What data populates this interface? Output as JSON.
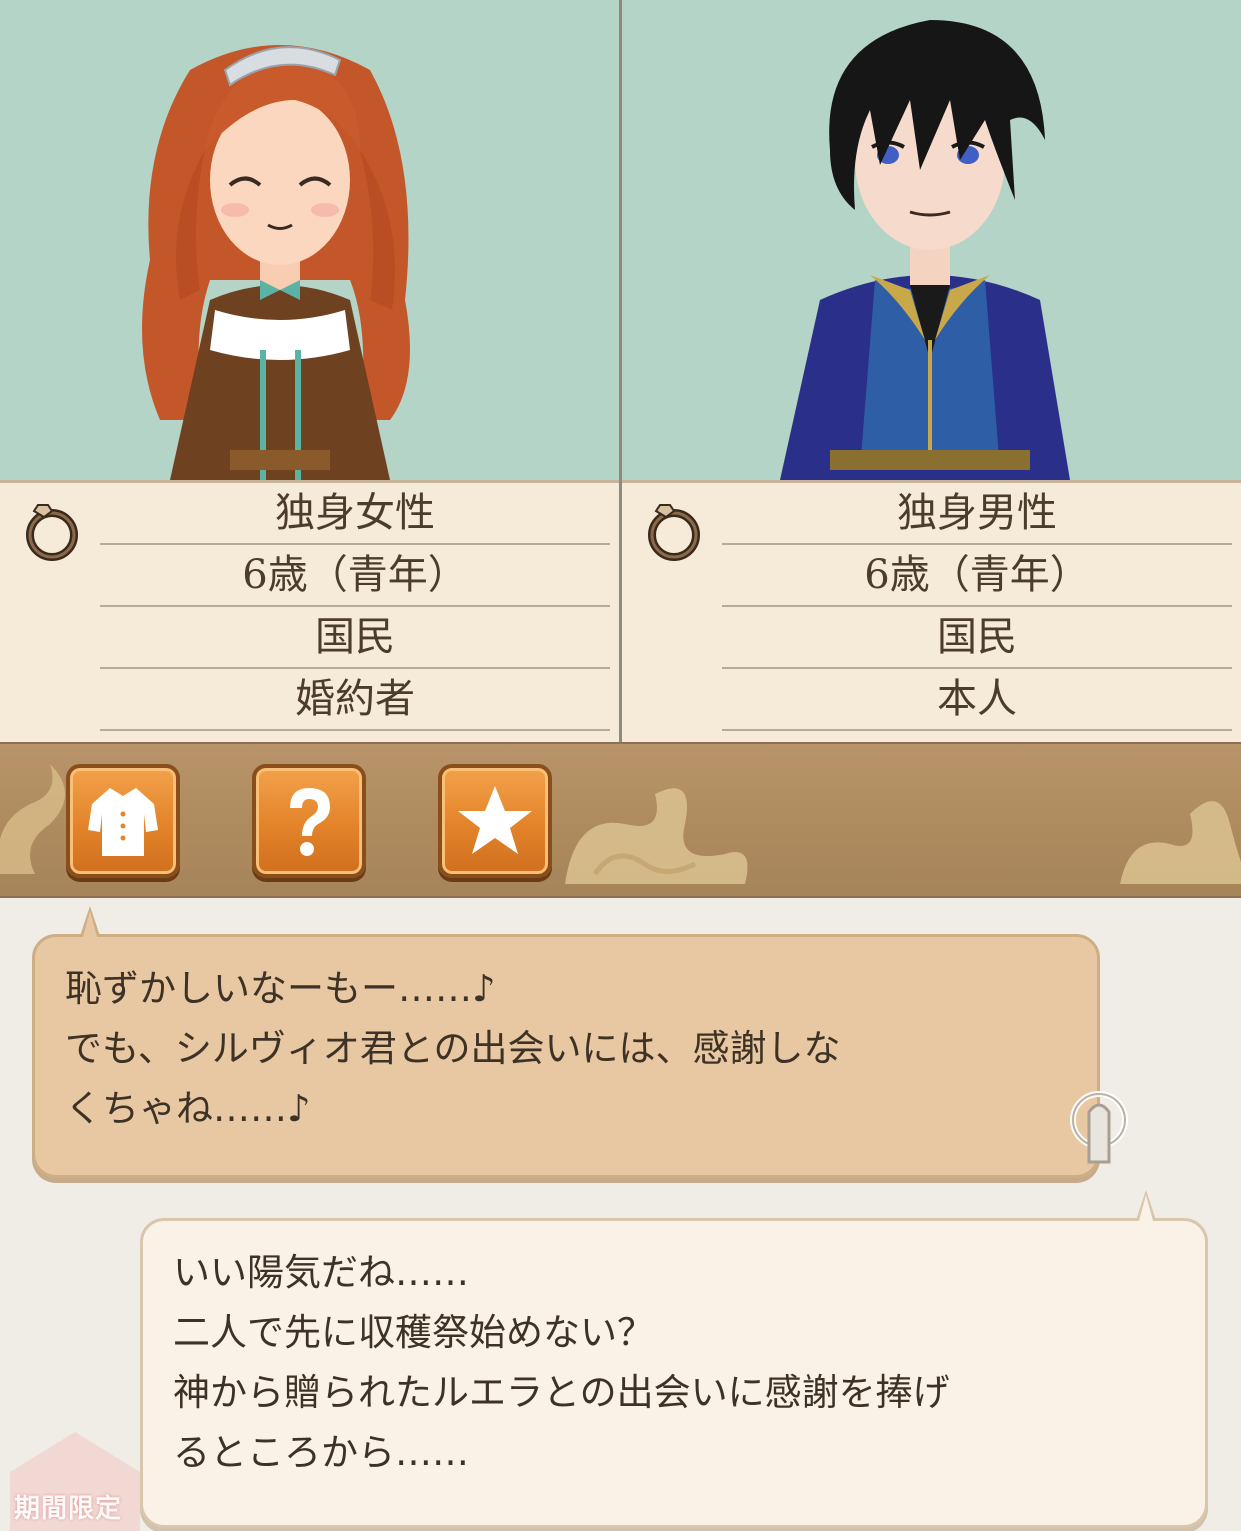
{
  "characters": [
    {
      "status": "独身女性",
      "age": "6歳（青年）",
      "role": "国民",
      "relation": "婚約者"
    },
    {
      "status": "独身男性",
      "age": "6歳（青年）",
      "role": "国民",
      "relation": "本人"
    }
  ],
  "toolbar": {
    "buttons": [
      {
        "icon": "outfit-icon"
      },
      {
        "icon": "question-icon"
      },
      {
        "icon": "star-icon"
      }
    ]
  },
  "dialogue": {
    "left": {
      "lines": [
        "恥ずかしいなーもー……♪",
        "でも、シルヴィオ君との出会いには、感謝しな",
        "くちゃね……♪"
      ]
    },
    "right": {
      "lines": [
        "いい陽気だね……",
        "二人で先に収穫祭始めない？",
        "神から贈られたルエラとの出会いに感謝を捧げ",
        "るところから……"
      ]
    }
  },
  "badge": {
    "limited": "期間限定"
  },
  "colors": {
    "portrait_bg": "#b3d4c6",
    "info_bg": "#f6ead9",
    "toolbar_bg": "#b9946a",
    "button_orange": "#e3832a",
    "bubble_left": "#e7c8a2",
    "bubble_right": "#faf2e6"
  }
}
